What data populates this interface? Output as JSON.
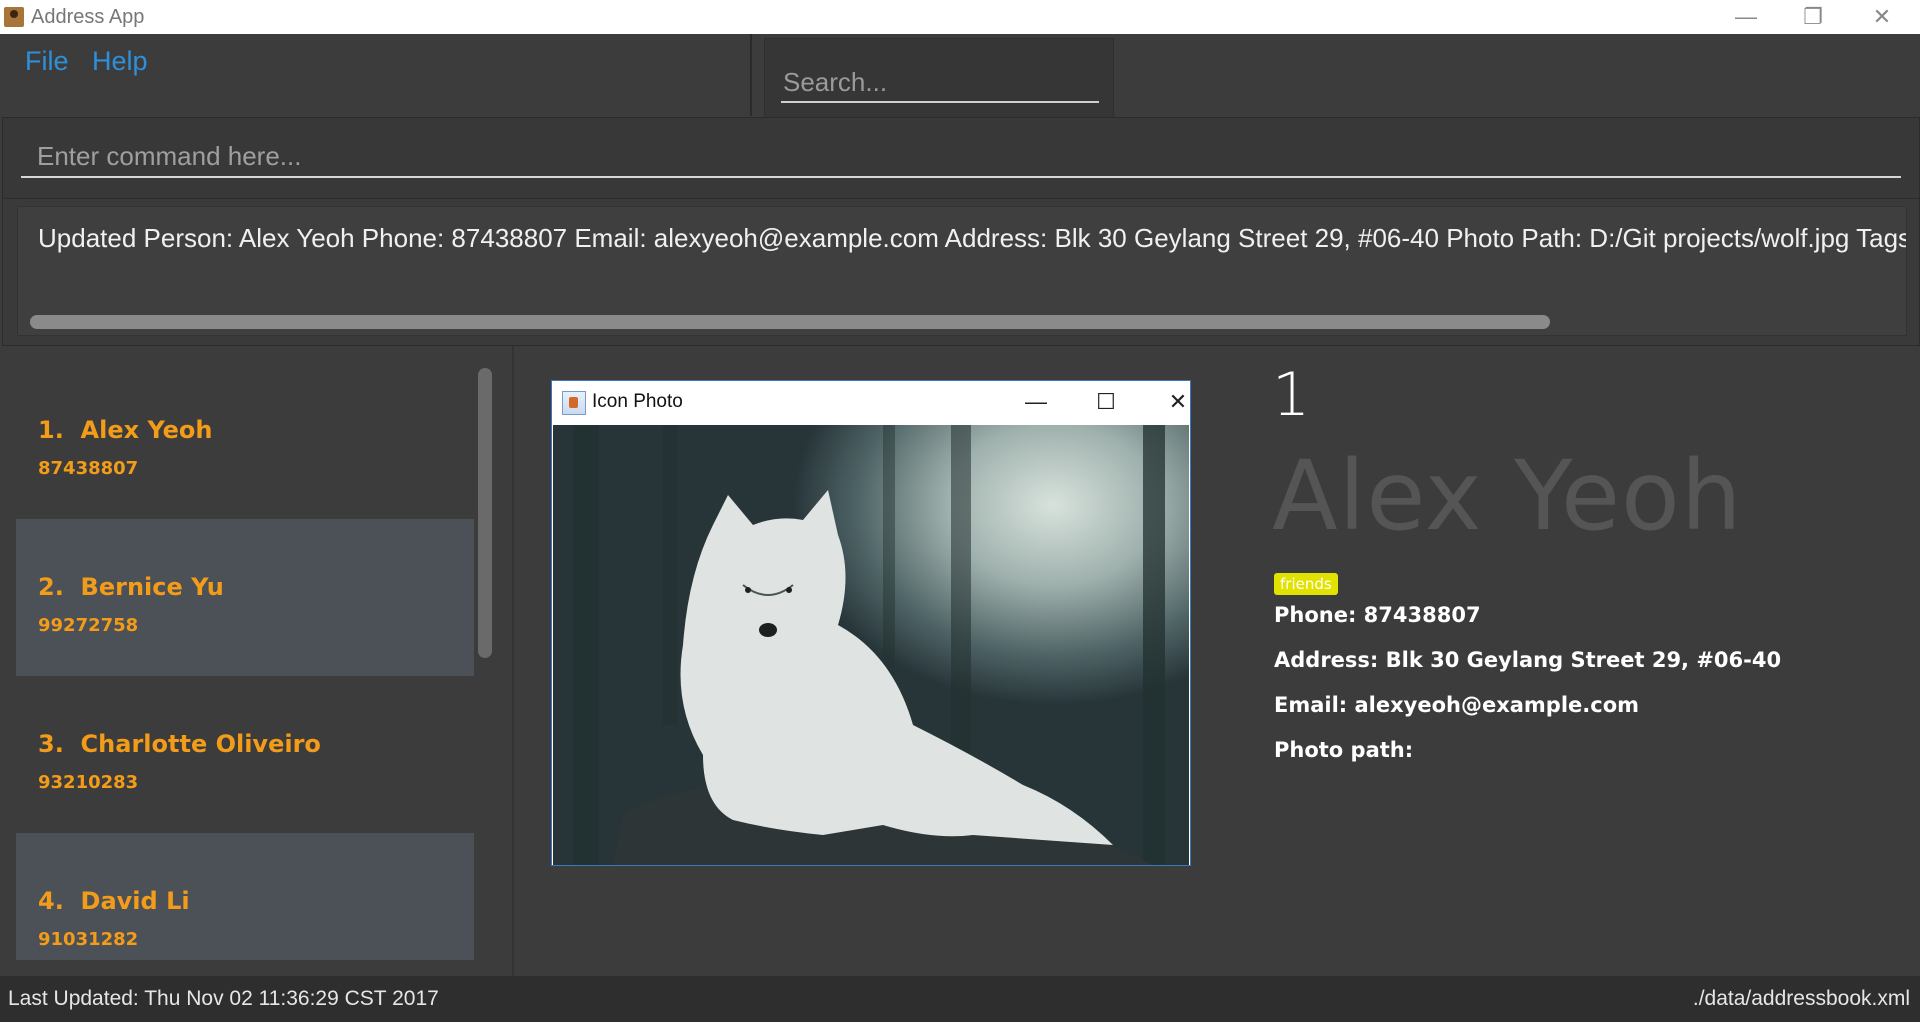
{
  "window": {
    "title": "Address App",
    "controls": {
      "minimize": "—",
      "restore": "❐",
      "close": "✕"
    }
  },
  "menu": {
    "file": "File",
    "help": "Help"
  },
  "search": {
    "placeholder": "Search..."
  },
  "command": {
    "placeholder": "Enter command here..."
  },
  "result": {
    "text": "Updated Person: Alex Yeoh Phone: 87438807 Email: alexyeoh@example.com Address: Blk 30 Geylang Street 29, #06-40 Photo Path: D:/Git projects/wolf.jpg Tags: [friends] E"
  },
  "person_list": [
    {
      "index": "1.",
      "name": "Alex Yeoh",
      "phone": "87438807"
    },
    {
      "index": "2.",
      "name": "Bernice Yu",
      "phone": "99272758"
    },
    {
      "index": "3.",
      "name": "Charlotte Oliveiro",
      "phone": "93210283"
    },
    {
      "index": "4.",
      "name": "David Li",
      "phone": "91031282"
    }
  ],
  "photo_window": {
    "title": "Icon Photo",
    "controls": {
      "minimize": "—",
      "maximize": "☐",
      "close": "✕"
    }
  },
  "details": {
    "index": "1",
    "name": "Alex Yeoh",
    "tag": "friends",
    "phone": "Phone: 87438807",
    "address": "Address: Blk 30 Geylang Street 29, #06-40",
    "email": "Email: alexyeoh@example.com",
    "photo_path": "Photo path:"
  },
  "status": {
    "last_updated": "Last Updated: Thu Nov 02 11:36:29 CST 2017",
    "file_path": "./data/addressbook.xml"
  }
}
